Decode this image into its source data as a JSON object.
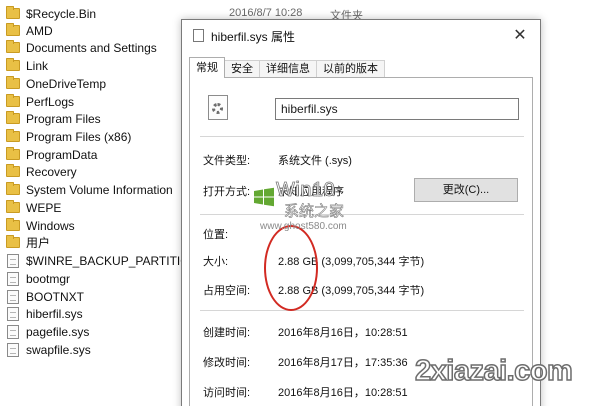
{
  "explorer": {
    "items": [
      {
        "name": "$Recycle.Bin",
        "type": "folder"
      },
      {
        "name": "AMD",
        "type": "folder"
      },
      {
        "name": "Documents and Settings",
        "type": "folder"
      },
      {
        "name": "Link",
        "type": "folder"
      },
      {
        "name": "OneDriveTemp",
        "type": "folder"
      },
      {
        "name": "PerfLogs",
        "type": "folder"
      },
      {
        "name": "Program Files",
        "type": "folder"
      },
      {
        "name": "Program Files (x86)",
        "type": "folder"
      },
      {
        "name": "ProgramData",
        "type": "folder"
      },
      {
        "name": "Recovery",
        "type": "folder"
      },
      {
        "name": "System Volume Information",
        "type": "folder"
      },
      {
        "name": "WEPE",
        "type": "folder"
      },
      {
        "name": "Windows",
        "type": "folder"
      },
      {
        "name": "用户",
        "type": "folder"
      },
      {
        "name": "$WINRE_BACKUP_PARTITION.M",
        "type": "file"
      },
      {
        "name": "bootmgr",
        "type": "file"
      },
      {
        "name": "BOOTNXT",
        "type": "file"
      },
      {
        "name": "hiberfil.sys",
        "type": "file"
      },
      {
        "name": "pagefile.sys",
        "type": "file"
      },
      {
        "name": "swapfile.sys",
        "type": "file"
      }
    ],
    "recycle_date": "2016/8/7 10:28",
    "recycle_type": "文件夹"
  },
  "dialog": {
    "title": "hiberfil.sys 属性",
    "close_glyph": "✕",
    "tabs": [
      "常规",
      "安全",
      "详细信息",
      "以前的版本"
    ],
    "active_tab": "常规",
    "filename": "hiberfil.sys",
    "file_type_label": "文件类型:",
    "file_type_value": "系统文件 (.sys)",
    "open_with_label": "打开方式:",
    "open_with_value": "未知应用程序",
    "change_button": "更改(C)...",
    "location_label": "位置:",
    "size_label": "大小:",
    "size_value": "2.88 GB (3,099,705,344 字节)",
    "size_on_disk_label": "占用空间:",
    "size_on_disk_value": "2.88 GB (3,099,705,344 字节)",
    "created_label": "创建时间:",
    "created_value": "2016年8月16日，10:28:51",
    "modified_label": "修改时间:",
    "modified_value": "2016年8月17日，17:35:36",
    "accessed_label": "访问时间:",
    "accessed_value": "2016年8月16日，10:28:51"
  },
  "watermarks": {
    "win10": "Win10",
    "sys_home": "系统之家",
    "url": "www.ghost580.com",
    "site": "2xiazai.com"
  },
  "colors": {
    "folder": "#e9c045",
    "highlight_ellipse": "#d22a22"
  }
}
